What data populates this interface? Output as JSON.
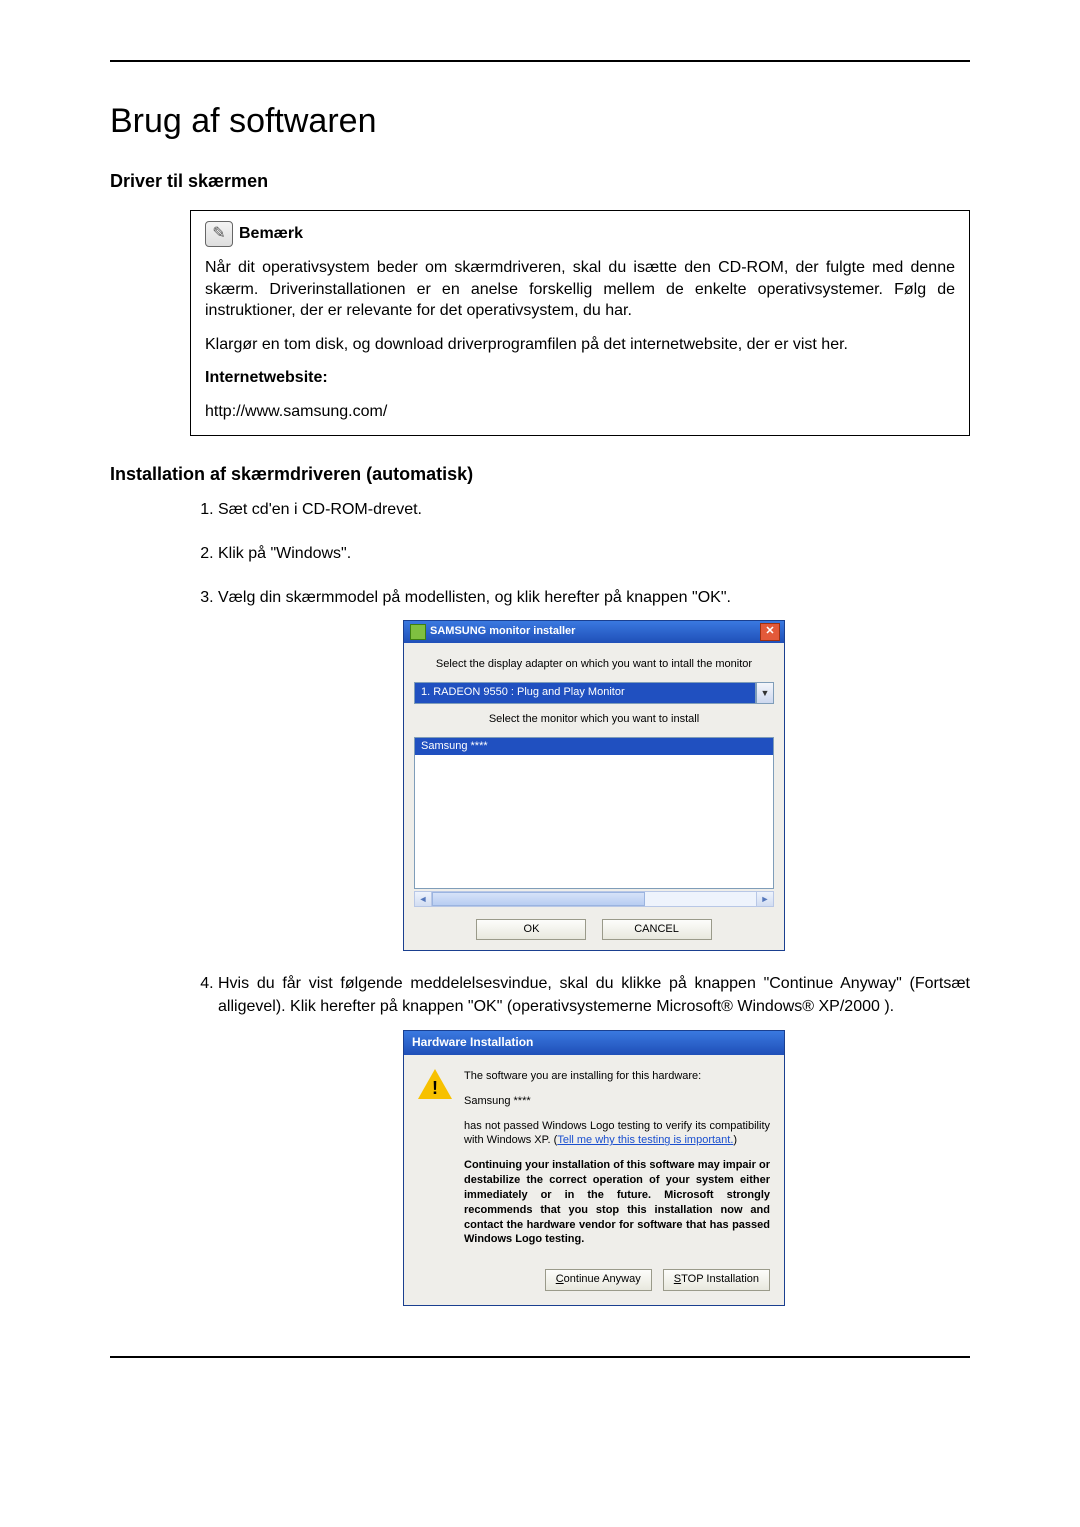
{
  "page_title": "Brug af softwaren",
  "section1_title": "Driver til skærmen",
  "note": {
    "label": "Bemærk",
    "p1": "Når dit operativsystem beder om skærmdriveren, skal du isætte den CD-ROM, der fulgte med denne skærm. Driverinstallationen er en anelse forskellig mellem de enkelte operativsystemer. Følg de instruktioner, der er relevante for det operativsystem, du har.",
    "p2": "Klargør en tom disk, og download driverprogramfilen på det internetwebsite, der er vist her.",
    "internet_label": "Internetwebsite:",
    "url": "http://www.samsung.com/"
  },
  "section2_title": "Installation af skærmdriveren (automatisk)",
  "steps": {
    "s1": "Sæt cd'en i CD-ROM-drevet.",
    "s2": "Klik på \"Windows\".",
    "s3": "Vælg din skærmmodel på modellisten, og klik herefter på knappen \"OK\".",
    "s4": "Hvis du får vist følgende meddelelsesvindue, skal du klikke på knappen \"Continue Anyway\" (Fortsæt alligevel). Klik herefter på knappen \"OK\" (operativsystemerne Microsoft® Windows® XP/2000 )."
  },
  "installer": {
    "title": "SAMSUNG monitor installer",
    "instr1": "Select the display adapter on which you want to intall the monitor",
    "combo_value": "1. RADEON 9550 : Plug and Play Monitor",
    "instr2": "Select the monitor which you want to install",
    "list_selected": "Samsung ****",
    "ok": "OK",
    "cancel": "CANCEL"
  },
  "hwdlg": {
    "title": "Hardware Installation",
    "line1": "The software you are installing for this hardware:",
    "line2": "Samsung ****",
    "line3a": "has not passed Windows Logo testing to verify its compatibility with Windows XP. (",
    "line3link": "Tell me why this testing is important.",
    "line3b": ")",
    "bold": "Continuing your installation of this software may impair or destabilize the correct operation of your system either immediately or in the future. Microsoft strongly recommends that you stop this installation now and contact the hardware vendor for software that has passed Windows Logo testing.",
    "btn_continue_u": "C",
    "btn_continue_rest": "ontinue Anyway",
    "btn_stop_u": "S",
    "btn_stop_rest": "TOP Installation"
  }
}
